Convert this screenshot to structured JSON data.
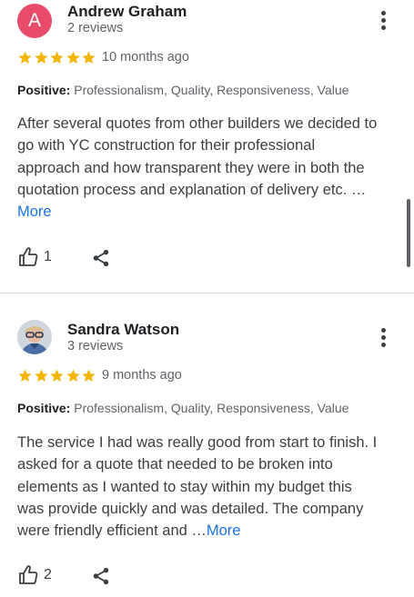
{
  "reviews": [
    {
      "avatar_letter": "A",
      "avatar_color": "#e94c6b",
      "name": "Andrew Graham",
      "review_count": "2 reviews",
      "rating": 5,
      "date": "10 months ago",
      "positive_label": "Positive:",
      "positive_values": " Professionalism, Quality, Responsiveness, Value",
      "body_lines": [
        "After several quotes from other builders we decided to",
        "go with YC construction for their professional",
        "approach and how transparent they were in both the",
        "quotation process and explanation of delivery etc. …"
      ],
      "more_label": "More",
      "likes": "1",
      "like_icon": "thumb-up-icon",
      "share_icon": "share-icon",
      "menu_icon": "more-vert-icon"
    },
    {
      "avatar_image": "profile-photo",
      "name": "Sandra Watson",
      "review_count": "3 reviews",
      "rating": 5,
      "date": "9 months ago",
      "positive_label": "Positive:",
      "positive_values": " Professionalism, Quality, Responsiveness, Value",
      "body_lines": [
        "The service I had was really good from start to finish. I",
        "asked for a quote that needed to be broken into",
        "elements as I wanted to stay within my budget this",
        "was provide quickly and was detailed. The company",
        "were friendly efficient and …"
      ],
      "more_label": "More",
      "likes": "2",
      "like_icon": "thumb-up-icon",
      "share_icon": "share-icon",
      "menu_icon": "more-vert-icon"
    }
  ],
  "colors": {
    "star": "#f4b400",
    "link": "#1a73e8",
    "secondary_text": "#5f6368",
    "divider": "#dadce0"
  }
}
